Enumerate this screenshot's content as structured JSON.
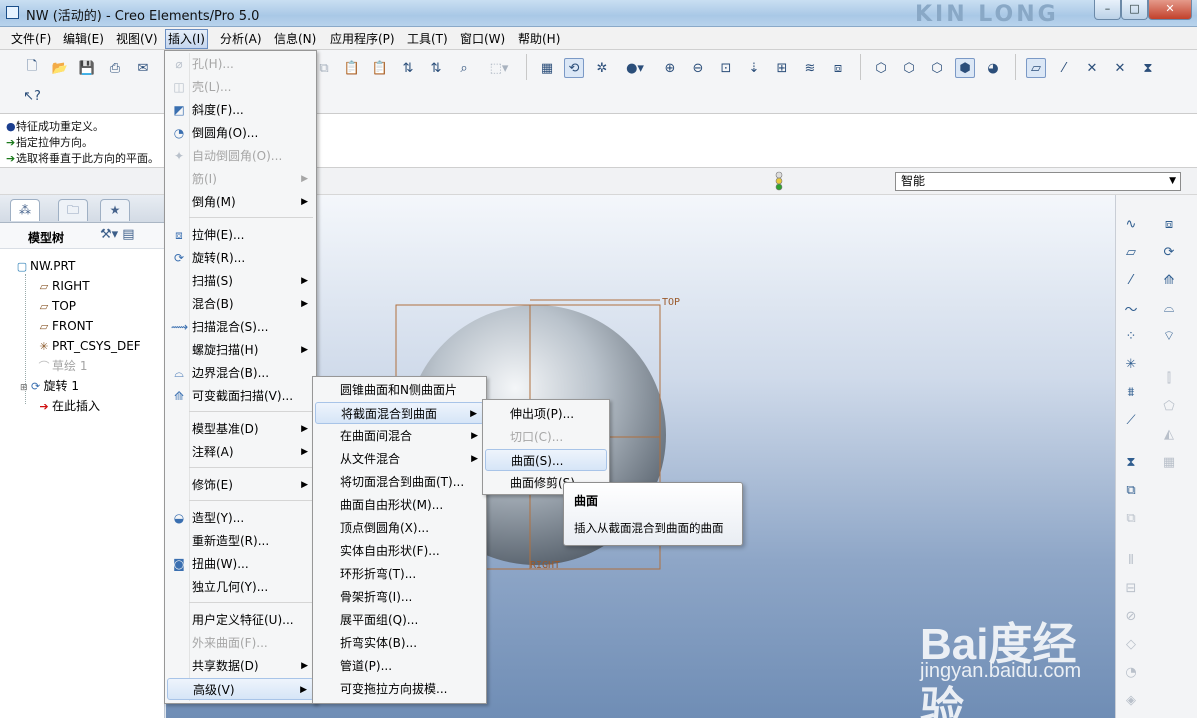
{
  "window": {
    "title": "NW (活动的) - Creo Elements/Pro 5.0",
    "watermark": "KIN LONG",
    "min": "–",
    "max": "□",
    "close": "✕"
  },
  "menubar": [
    "文件(F)",
    "编辑(E)",
    "视图(V)",
    "插入(I)",
    "分析(A)",
    "信息(N)",
    "应用程序(P)",
    "工具(T)",
    "窗口(W)",
    "帮助(H)"
  ],
  "messages": [
    {
      "marker": "●",
      "text": "特征成功重定义。"
    },
    {
      "marker": "➔",
      "text": "指定拉伸方向。"
    },
    {
      "marker": "➔",
      "text": "选取将垂直于此方向的平面。"
    }
  ],
  "filter": {
    "value": "智能"
  },
  "model_tree": {
    "title": "模型树",
    "items": [
      {
        "label": "NW.PRT",
        "icon": "part-icon",
        "dim": false
      },
      {
        "label": "RIGHT",
        "icon": "datum-plane-icon",
        "dim": false
      },
      {
        "label": "TOP",
        "icon": "datum-plane-icon",
        "dim": false
      },
      {
        "label": "FRONT",
        "icon": "datum-plane-icon",
        "dim": false
      },
      {
        "label": "PRT_CSYS_DEF",
        "icon": "csys-icon",
        "dim": false
      },
      {
        "label": "草绘 1",
        "icon": "sketch-icon",
        "dim": true
      },
      {
        "label": "旋转 1",
        "icon": "revolve-icon",
        "dim": false
      },
      {
        "label": "在此插入",
        "icon": "insert-here-arrow-icon",
        "dim": false
      }
    ]
  },
  "graphics": {
    "datum_top": "TOP",
    "datum_right": "RIGHT"
  },
  "insert_menu": {
    "items": [
      {
        "label": "孔(H)...",
        "disabled": true,
        "sub": false
      },
      {
        "label": "壳(L)...",
        "disabled": true,
        "sub": false
      },
      {
        "label": "斜度(F)...",
        "disabled": false,
        "sub": false
      },
      {
        "label": "倒圆角(O)...",
        "disabled": false,
        "sub": false
      },
      {
        "label": "自动倒圆角(O)...",
        "disabled": true,
        "sub": false
      },
      {
        "label": "筋(I)",
        "disabled": true,
        "sub": true
      },
      {
        "label": "倒角(M)",
        "disabled": false,
        "sub": true
      },
      {
        "label": "拉伸(E)...",
        "disabled": false,
        "sub": false
      },
      {
        "label": "旋转(R)...",
        "disabled": false,
        "sub": false
      },
      {
        "label": "扫描(S)",
        "disabled": false,
        "sub": true
      },
      {
        "label": "混合(B)",
        "disabled": false,
        "sub": true
      },
      {
        "label": "扫描混合(S)...",
        "disabled": false,
        "sub": false
      },
      {
        "label": "螺旋扫描(H)",
        "disabled": false,
        "sub": true
      },
      {
        "label": "边界混合(B)...",
        "disabled": false,
        "sub": false
      },
      {
        "label": "可变截面扫描(V)...",
        "disabled": false,
        "sub": false
      },
      {
        "label": "模型基准(D)",
        "disabled": false,
        "sub": true
      },
      {
        "label": "注释(A)",
        "disabled": false,
        "sub": true
      },
      {
        "label": "修饰(E)",
        "disabled": false,
        "sub": true
      },
      {
        "label": "造型(Y)...",
        "disabled": false,
        "sub": false
      },
      {
        "label": "重新造型(R)...",
        "disabled": false,
        "sub": false
      },
      {
        "label": "扭曲(W)...",
        "disabled": false,
        "sub": false
      },
      {
        "label": "独立几何(Y)...",
        "disabled": false,
        "sub": false
      },
      {
        "label": "用户定义特征(U)...",
        "disabled": false,
        "sub": false
      },
      {
        "label": "外来曲面(F)...",
        "disabled": true,
        "sub": false
      },
      {
        "label": "共享数据(D)",
        "disabled": false,
        "sub": true
      },
      {
        "label": "高级(V)",
        "disabled": false,
        "sub": true
      }
    ]
  },
  "advanced_menu": {
    "items": [
      "圆锥曲面和N侧曲面片",
      "将截面混合到曲面",
      "在曲面间混合",
      "从文件混合",
      "将切面混合到曲面(T)...",
      "曲面自由形状(M)...",
      "顶点倒圆角(X)...",
      "实体自由形状(F)...",
      "环形折弯(T)...",
      "骨架折弯(I)...",
      "展平面组(Q)...",
      "折弯实体(B)...",
      "管道(P)...",
      "可变拖拉方向拔模..."
    ]
  },
  "blend_menu": {
    "items": [
      {
        "label": "伸出项(P)...",
        "disabled": false
      },
      {
        "label": "切口(C)...",
        "disabled": true
      },
      {
        "label": "曲面(S)...",
        "disabled": false
      },
      {
        "label": "曲面修剪(S)",
        "disabled": false
      }
    ]
  },
  "tooltip": {
    "title": "曲面",
    "body": "插入从截面混合到曲面的曲面"
  },
  "baidu": {
    "logo": "Bai度经验",
    "url": "jingyan.baidu.com"
  }
}
